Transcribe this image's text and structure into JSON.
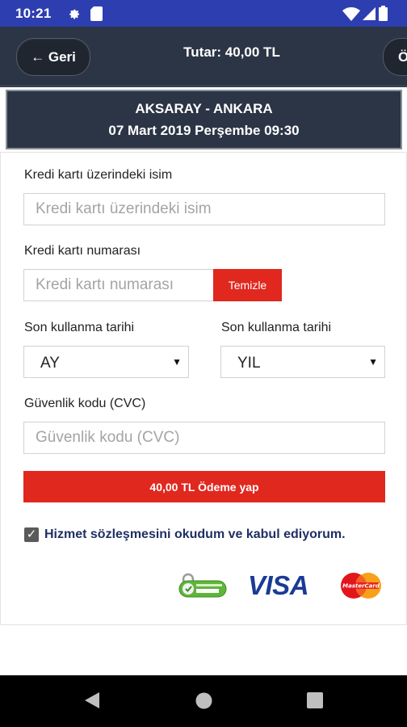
{
  "status_bar": {
    "time": "10:21",
    "icons": [
      "settings-icon",
      "sd-card-icon",
      "wifi-icon",
      "signal-icon",
      "battery-icon"
    ]
  },
  "header": {
    "back_label": "← Geri",
    "title": "Tutar: 40,00 TL",
    "next_label": "Ö"
  },
  "trip": {
    "route": "AKSARAY - ANKARA",
    "date": "07 Mart 2019 Perşembe 09:30"
  },
  "form": {
    "name_label": "Kredi kartı üzerindeki isim",
    "name_placeholder": "Kredi kartı üzerindeki isim",
    "number_label": "Kredi kartı numarası",
    "number_placeholder": "Kredi kartı numarası",
    "clear_label": "Temizle",
    "month_label": "Son kullanma tarihi",
    "month_value": "AY",
    "year_label": "Son kullanma tarihi",
    "year_value": "YIL",
    "cvc_label": "Güvenlik kodu (CVC)",
    "cvc_placeholder": "Güvenlik kodu (CVC)",
    "pay_label": "40,00 TL Ödeme yap",
    "agree_checked": true,
    "agree_text": "Hizmet sözleşmesini okudum ve kabul ediyorum."
  },
  "logos": {
    "secure": "secure-logo",
    "visa_text": "VISA",
    "mastercard": "mastercard-logo"
  },
  "colors": {
    "status_bar": "#2d3fb0",
    "header": "#2c3545",
    "accent_red": "#e0281e",
    "agree_text": "#1f2f64"
  }
}
